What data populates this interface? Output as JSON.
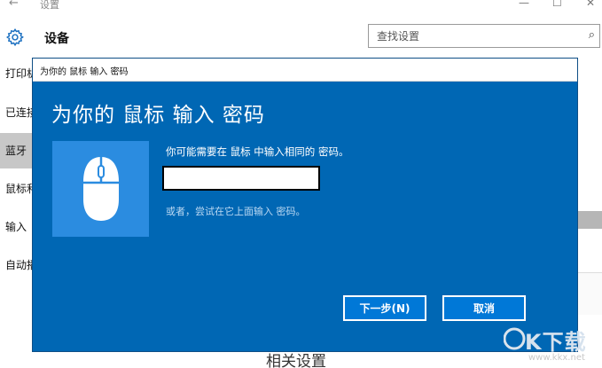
{
  "window": {
    "back_glyph": "←",
    "title": "设置",
    "controls": [
      "—",
      "☐",
      "✕"
    ]
  },
  "header": {
    "title": "设备",
    "search_placeholder": "查找设置",
    "search_glyph": "⌕"
  },
  "sidebar": {
    "items": [
      {
        "label": "打印机和扫描仪"
      },
      {
        "label": "已连接的设备"
      },
      {
        "label": "蓝牙"
      },
      {
        "label": "鼠标和触摸板"
      },
      {
        "label": "输入"
      },
      {
        "label": "自动播放"
      }
    ],
    "selected_index": 2
  },
  "background_content": {
    "heading": "相关设置"
  },
  "dialog": {
    "title": "为你的 鼠标 输入 密码",
    "heading": "为你的 鼠标 输入 密码",
    "prompt": "你可能需要在 鼠标 中输入相同的 密码。",
    "passcode_value": "",
    "alternative": "或者，尝试在它上面输入 密码。",
    "next_button": "下一步(N)",
    "cancel_button": "取消",
    "device_icon": "mouse-icon"
  },
  "colors": {
    "dialog_bg": "#0067b4",
    "tile_bg": "#2b8ce0",
    "button_bg": "#0078d7",
    "selected_nav": "#c7c7c7"
  },
  "watermark": {
    "text": "K下载",
    "url": "www.kkx.net"
  }
}
